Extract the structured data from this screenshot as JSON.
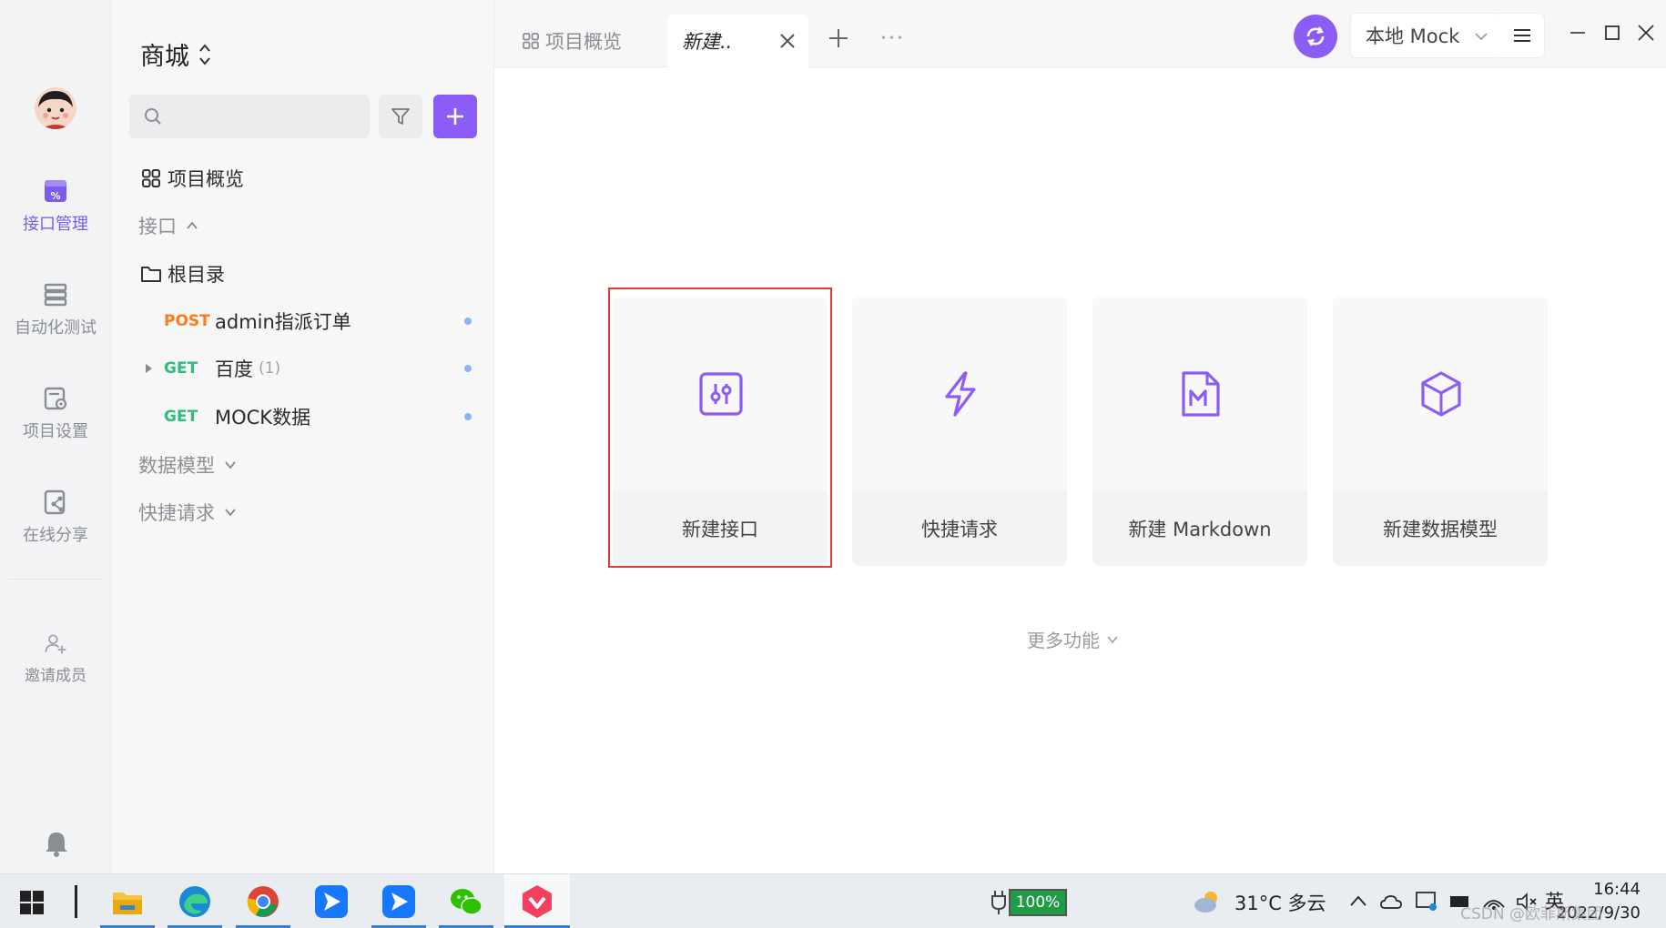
{
  "rail": {
    "items": [
      {
        "label": "接口管理",
        "icon": "api-icon",
        "active": true
      },
      {
        "label": "自动化测试",
        "icon": "automation-icon"
      },
      {
        "label": "项目设置",
        "icon": "settings-icon"
      },
      {
        "label": "在线分享",
        "icon": "share-icon"
      }
    ],
    "invite_label": "邀请成员"
  },
  "sidebar": {
    "project_name": "商城",
    "search_placeholder": "",
    "overview_label": "项目概览",
    "interfaces_label": "接口",
    "root_folder_label": "根目录",
    "endpoints": [
      {
        "method": "POST",
        "name": "admin指派订单",
        "count": ""
      },
      {
        "method": "GET",
        "name": "百度",
        "count": "(1)"
      },
      {
        "method": "GET",
        "name": "MOCK数据",
        "count": ""
      }
    ],
    "data_models_label": "数据模型",
    "quick_requests_label": "快捷请求"
  },
  "tabs": {
    "overview_label": "项目概览",
    "new_tab_label": "新建..",
    "more_label": "···"
  },
  "toolbar": {
    "env_label": "本地 Mock"
  },
  "main": {
    "cards": [
      {
        "label": "新建接口",
        "icon": "new-api-icon"
      },
      {
        "label": "快捷请求",
        "icon": "lightning-icon"
      },
      {
        "label": "新建 Markdown",
        "icon": "markdown-icon"
      },
      {
        "label": "新建数据模型",
        "icon": "cube-icon"
      }
    ],
    "more_features_label": "更多功能"
  },
  "taskbar": {
    "battery_label": "100%",
    "weather_label": "31°C  多云",
    "ime_label": "英",
    "time": "16:44",
    "date": "2022/9/30",
    "watermark": "CSDN @欧菲斯集团"
  },
  "colors": {
    "accent": "#8b5cf6",
    "post": "#ff7a1a",
    "get": "#2ebd7a",
    "highlight": "#e53935"
  }
}
